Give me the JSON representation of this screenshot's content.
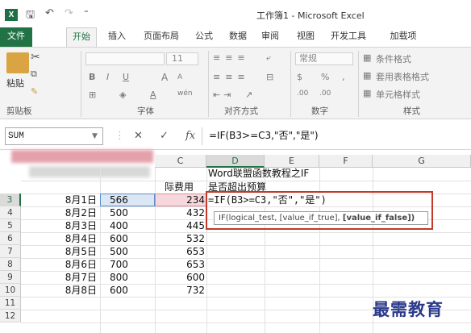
{
  "app": {
    "logo_text": "X",
    "title": "工作簿1 - Microsoft Excel"
  },
  "quick_access": {
    "save": "🖫",
    "undo": "↶",
    "redo": "↷",
    "customize": "⁼"
  },
  "tabs": [
    {
      "label": "文件",
      "file": true
    },
    {
      "label": "开始",
      "active": true
    },
    {
      "label": "插入"
    },
    {
      "label": "页面布局"
    },
    {
      "label": "公式"
    },
    {
      "label": "数据"
    },
    {
      "label": "审阅"
    },
    {
      "label": "视图"
    },
    {
      "label": "开发工具"
    },
    {
      "label": "加载项"
    }
  ],
  "ribbon": {
    "clipboard": {
      "paste_label": "粘贴",
      "group_label": "剪贴板"
    },
    "font": {
      "size": "11",
      "bold": "B",
      "italic": "I",
      "underline": "U",
      "grow": "A",
      "shrink": "A",
      "font_color": "A",
      "phonetic": "wén",
      "group_label": "字体"
    },
    "alignment": {
      "group_label": "对齐方式"
    },
    "number": {
      "format": "常规",
      "currency": "$",
      "percent": "%",
      "comma": ",",
      "inc_dec": ".00",
      "dec_dec": ".00",
      "group_label": "数字"
    },
    "styles": {
      "conditional": "条件格式",
      "table": "套用表格格式",
      "cell_styles": "单元格样式",
      "group_label": "样式"
    }
  },
  "formula_bar": {
    "name_box": "SUM",
    "cancel": "✕",
    "enter": "✓",
    "fx": "fx",
    "formula": "=IF(B3>=C3,\"否\",\"是\")"
  },
  "columns": [
    "C",
    "D",
    "E",
    "F",
    "G"
  ],
  "rows": [
    "3",
    "4",
    "5",
    "6",
    "7",
    "8",
    "9",
    "10",
    "11",
    "12"
  ],
  "cells": {
    "d1": "Word联盟函数教程之IF",
    "c2_partial": "际费用",
    "d2": "是否超出预算",
    "dates": [
      "8月1日",
      "8月2日",
      "8月3日",
      "8月4日",
      "8月5日",
      "8月6日",
      "8月7日",
      "8月8日"
    ],
    "budget": [
      "566",
      "500",
      "400",
      "600",
      "500",
      "700",
      "800",
      "600"
    ],
    "actual": [
      "234",
      "432",
      "445",
      "532",
      "653",
      "653",
      "600",
      "732"
    ],
    "editing_formula": "=IF(B3>=C3,\"否\",\"是\")"
  },
  "tooltip": {
    "text": "IF(logical_test, [value_if_true], ",
    "bold": "[value_if_false])"
  },
  "watermark": "最需教育",
  "colors": {
    "accent": "#217346",
    "annotation": "#c0392b"
  }
}
